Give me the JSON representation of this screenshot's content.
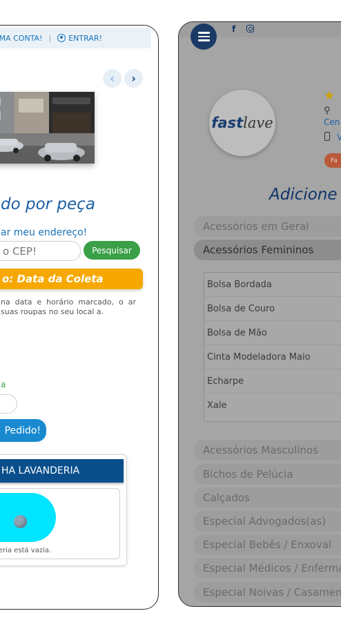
{
  "left_screen": {
    "header": {
      "create_account": "RIAR UMA CONTA!",
      "separator": "|",
      "login": "ENTRAR!"
    },
    "carousel": {
      "prev_icon": "chevron-left-icon",
      "next_icon": "chevron-right-icon"
    },
    "section_title": "do por peça",
    "address_link": "ar meu endereço!",
    "cep_input": {
      "placeholder": "e o CEP!"
    },
    "search_button": "Pesquisar",
    "collection_banner": "o: Data da Coleta",
    "collection_description": "na data e horário marcado, o ar suas roupas no seu local a.",
    "green_label": "a",
    "order_button": "Pedido!",
    "laundry": {
      "title": "HA LAVANDERIA",
      "empty_message": "avanderia está vazia."
    }
  },
  "right_screen": {
    "social": {
      "facebook": "f",
      "instagram_icon": "instagram-icon"
    },
    "logo": {
      "part1": "fast",
      "part2": "lave"
    },
    "store_info": {
      "star": "★",
      "pin": "⚲",
      "city": "Cen",
      "phone_link": "V",
      "status_badge": "Fa"
    },
    "title": "Adicione d",
    "categories": [
      "Acessórios em Geral",
      "Acessórios Femininos",
      "Acessórios Masculinos",
      "Bichos de Pelúcia",
      "Calçados",
      "Especial Advogados(as)",
      "Especial Bebês / Enxoval",
      "Especial Médicos / Enfermag",
      "Especial Noivas / Casamento"
    ],
    "subcategories": [
      "Bolsa Bordada",
      "Bolsa de Couro",
      "Bolsa de Mão",
      "Cinta Modeladora Maio",
      "Echarpe",
      "Xale"
    ]
  },
  "colors": {
    "primary_blue": "#1a73b7",
    "dark_navy": "#0a4f8c",
    "orange": "#f7a800",
    "green": "#3aa047",
    "cyan": "#00e5ff"
  }
}
